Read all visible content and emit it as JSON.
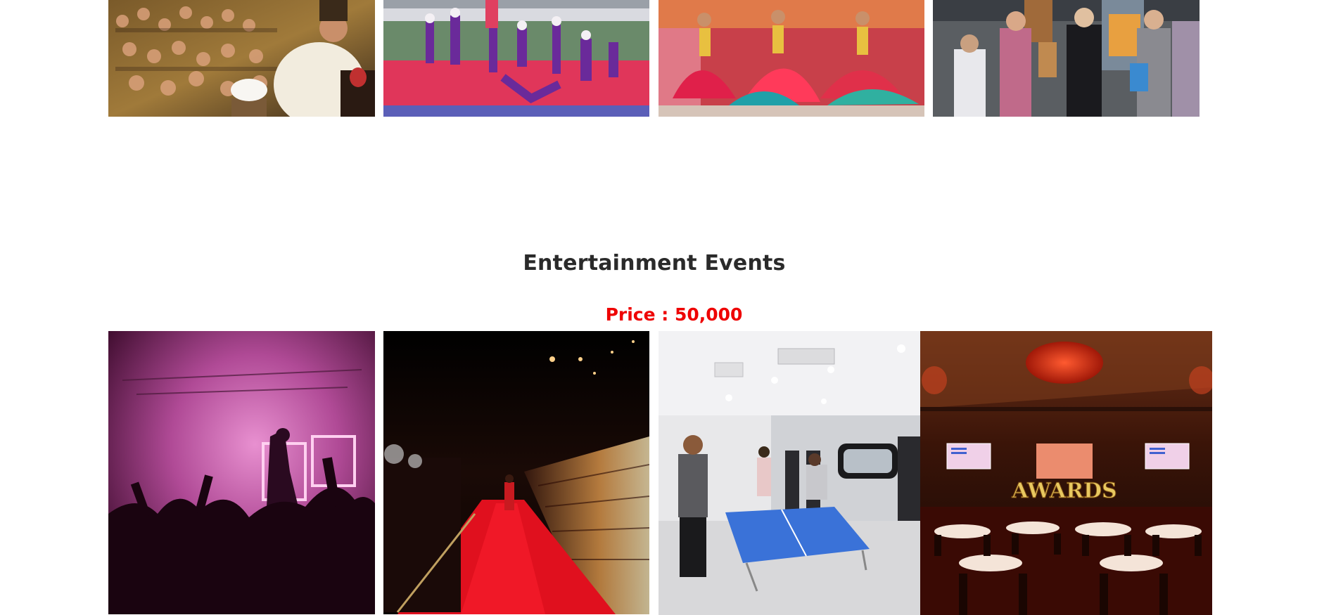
{
  "section": {
    "title": "Entertainment Events",
    "price": "Price : 50,000"
  },
  "colors": {
    "title": "#2a2a2a",
    "price": "#ee0000",
    "background": "#ffffff"
  },
  "photos": {
    "top_row": [
      "crowd-performance-photo",
      "gymnastics-photo",
      "folk-dance-photo",
      "art-exhibition-photo"
    ],
    "bottom_row": [
      "concert-photo",
      "red-carpet-photo",
      "table-tennis-photo",
      "awards-night-photo"
    ]
  },
  "awards_sign": "AWARDS"
}
